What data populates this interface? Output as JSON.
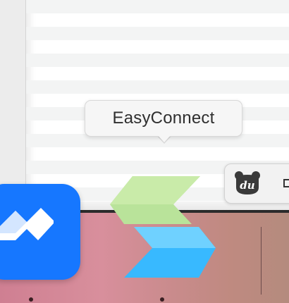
{
  "tooltip": {
    "text": "EasyConnect"
  },
  "status_bar": {
    "du_icon_label": "du"
  },
  "dock": {
    "apps": [
      {
        "name": "feishu-app",
        "icon": "blue-stacked-chevrons-icon"
      },
      {
        "name": "easyconnect-app",
        "icon": "green-blue-chevrons-icon"
      }
    ]
  },
  "colors": {
    "app_blue": "#1677ff",
    "ec_green": "#b9e39a",
    "ec_blue": "#38b9ff"
  }
}
